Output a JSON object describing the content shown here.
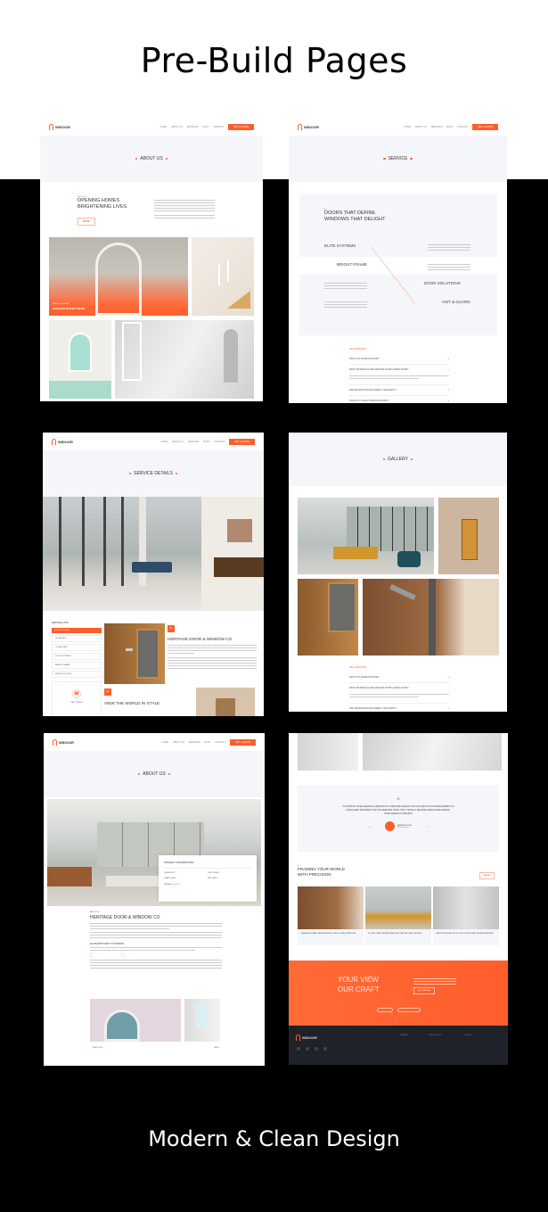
{
  "header": {
    "title": "Pre-Build Pages"
  },
  "footer": {
    "title": "Modern & Clean Design"
  },
  "brand": {
    "logo_text": "WIDOOR",
    "accent": "#ff5e2b"
  },
  "nav": {
    "links": [
      "HOME",
      "ABOUT US",
      "SERVICES",
      "BLOG",
      "CONTACT"
    ],
    "cta": "GET A QUOTE"
  },
  "pages": {
    "about": {
      "hero": "ABOUT US",
      "eyebrow": "ABOUT US",
      "heading_line1": "OPENING HOMES",
      "heading_line2": "BRIGHTENING LIVES",
      "button": "MORE",
      "overlay_sub": "WELCOME DESIGN",
      "overlay_title": "ELEGANCE IN EVERY ENTRY"
    },
    "service": {
      "hero": "SERVICE",
      "heading_line1": "DOORS THAT DEFINE",
      "heading_line2": "WINDOWS THAT DELIGHT",
      "features": [
        "ELITE SYSTEMS",
        "BRIGHT FRAME",
        "DOOR SOLUTIONS",
        "VIST & GUARD"
      ],
      "faq_label": "ASK QUESTION",
      "faqs": [
        "WHAT IS A WINDOW DOOR?",
        "WHAT MATERIALS ARE WINDOW DOORS MADE FROM?",
        "ARE WINDOW DOORS ENERGY EFFICIENT?",
        "HOW DO I CLEAN WINDOW DOORS?"
      ]
    },
    "service_details": {
      "hero": "SERVICE DETAILS",
      "sidebar_title": "SERVICE LISTS",
      "sidebar_items": [
        "ELITE SYSTEMS",
        "VISTA VIEW",
        "CLEAR GATE",
        "DOOR SYSTEMS",
        "BRIGHT FRAME",
        "WINDOW DOORS"
      ],
      "contact_label": "GET TOUCH",
      "badge1": "01",
      "heading1": "HERITAGE DOOR & WINDOW CO",
      "badge2": "02",
      "heading2": "VIEW THE WORLD IN STYLE"
    },
    "gallery": {
      "hero": "GALLERY",
      "faq_label": "ASK QUESTION",
      "faqs": [
        "WHAT IS A WINDOW DOOR?",
        "WHAT MATERIALS ARE WINDOW DOORS MADE FROM?",
        "ARE WINDOW DOORS ENERGY EFFICIENT?"
      ]
    },
    "project": {
      "hero": "ABOUT US",
      "info_title": "PROJECT INFORMATION",
      "info_fields": [
        "CATEGORY",
        "CUSTOMER",
        "START DATE",
        "END DATE",
        "RATING"
      ],
      "eyebrow": "ABOUT US",
      "heading": "HERITAGE DOOR & WINDOW CO",
      "subheading": "ELITE BATTERY SYSTEMS",
      "prev": "PREVIOUS",
      "next": "NEXT"
    },
    "home": {
      "testimonial": "AI ARTIFICIAL INTELLIGENCE IS A BRANCH OF COMPUTER SCIENCE THAT FOCUSES ON THE DEVELOPMENT OF INTELLIGENT MACHINES THAT CAN PERFORM TASKS THAT TYPICALLY REQUIRE HUMAN INTELLIGENCE. INTELLIGENCE IS A BRANCH",
      "author": "ANDREW LEVE",
      "author_role": "Web Designer",
      "blog_heading_line1": "FRAMING YOUR WORLD",
      "blog_heading_line2": "WITH PRECISION",
      "blog_button": "VIEW ALL",
      "posts": [
        "OPENING HOMES, BRIGHTENING LIVES DOORS WINDOWS",
        "DOORS THAT DEFINE WINDOWS THAT DELIGHT SECURE",
        "VIEW THE WORLD IN STYLE DOORS THAT DEFINE WINDOWS"
      ],
      "cta_line1": "YOUR VIEW",
      "cta_line2": "OUR CRAFT",
      "cta_button": "GET STARTED",
      "footer_cols": [
        "COMPANY",
        "USEFUL LINKS",
        "CONTACT"
      ]
    }
  }
}
